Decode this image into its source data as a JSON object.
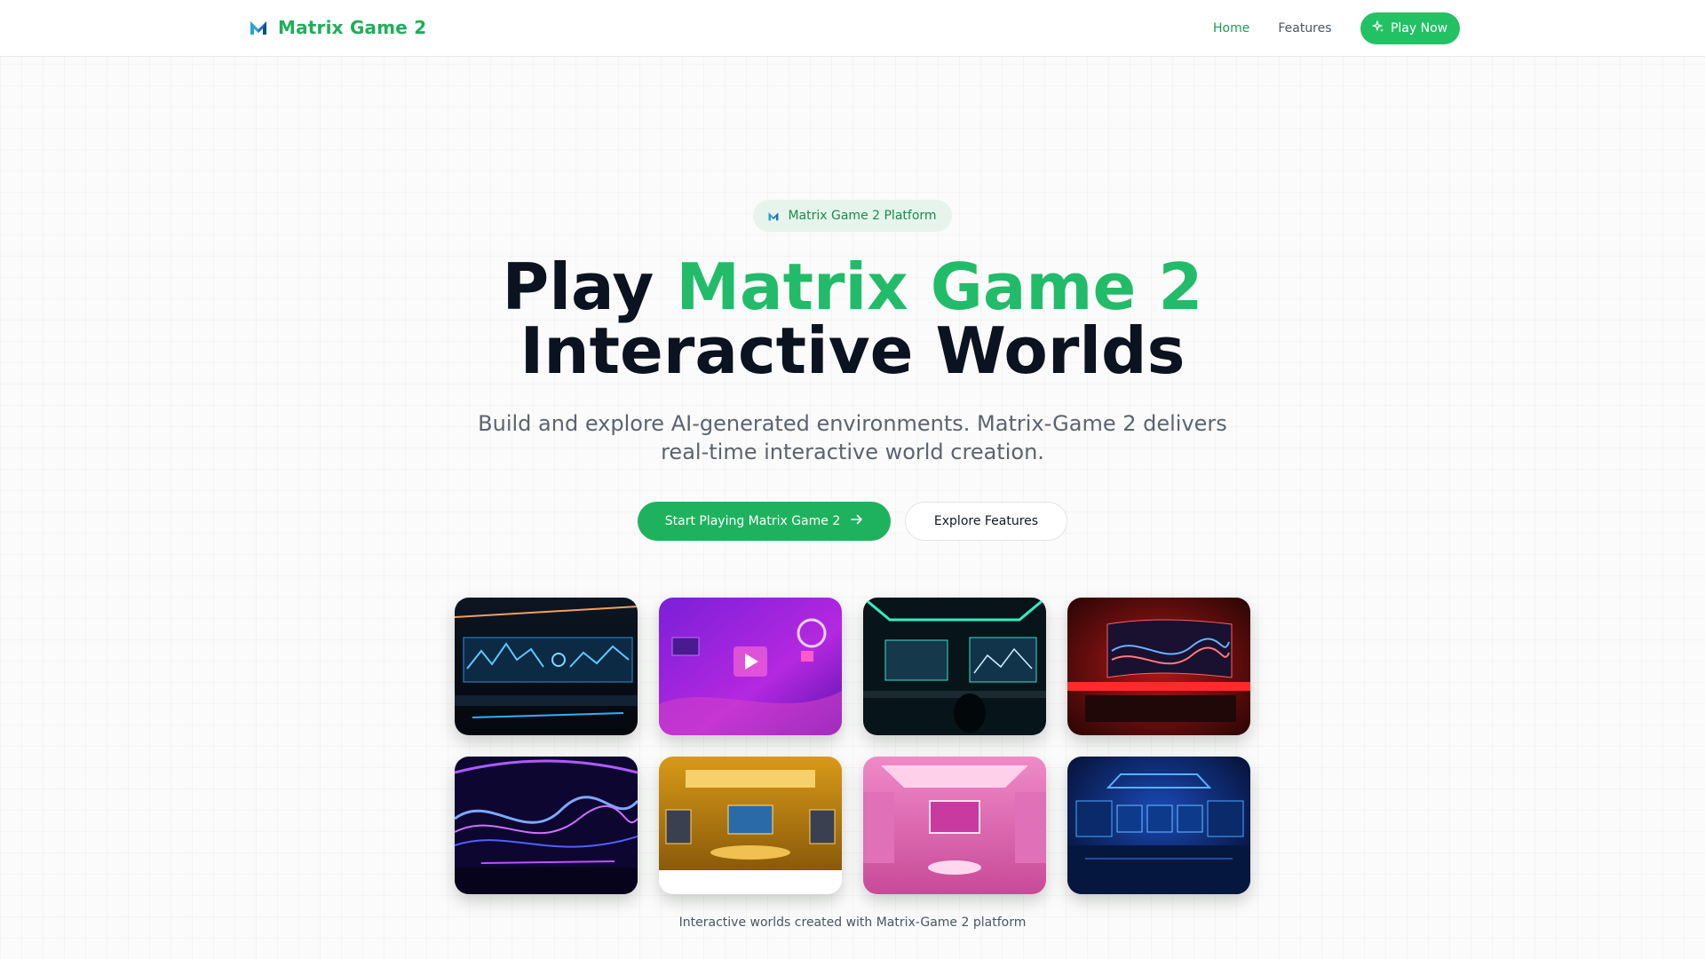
{
  "nav": {
    "brand": "Matrix Game 2",
    "logo_icon": "matrix-m-logo",
    "links": [
      "Home",
      "Features"
    ],
    "cta": "Play Now",
    "cta_icon": "sparkles-icon",
    "accent": "#22c164"
  },
  "hero": {
    "badge": "Matrix Game 2 Platform",
    "title_prefix": "Play",
    "title_accent": "Matrix Game 2",
    "title_rest": "Interactive Worlds",
    "subtitle": "Build and explore AI-generated environments. Matrix-Game 2 delivers real-time interactive world creation.",
    "primary_cta": "Start Playing Matrix Game 2",
    "primary_icon": "arrow-right-icon",
    "secondary_cta": "Explore Features"
  },
  "gallery": {
    "tiles": [
      "dark control room with data screens",
      "purple neon play room",
      "teal neon monitor room",
      "red curved monitor room",
      "purple wave light room",
      "golden studio room",
      "pink neon studio",
      "blue command center"
    ],
    "caption": "Interactive worlds created with Matrix-Game 2 platform"
  }
}
